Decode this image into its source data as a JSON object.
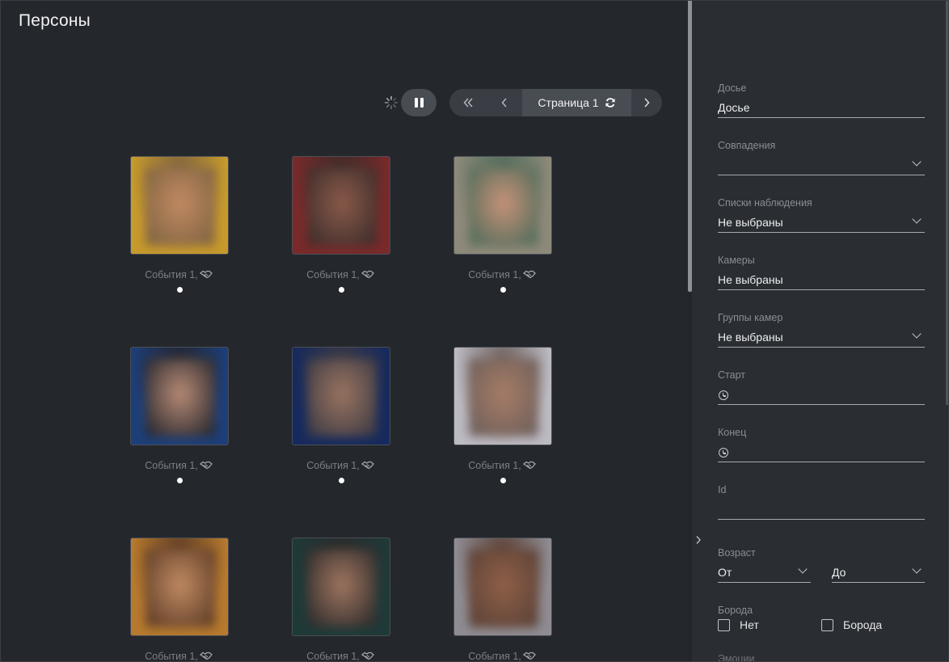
{
  "page": {
    "title": "Персоны"
  },
  "toolbar": {
    "loader_icon": "spinner-icon",
    "pause_icon": "pause-icon",
    "pager": {
      "first_icon": "double-chevron-left-icon",
      "prev_icon": "chevron-left-icon",
      "page_label": "Страница 1",
      "refresh_icon": "refresh-icon",
      "next_icon": "chevron-right-icon"
    }
  },
  "persons": [
    {
      "caption": "События 1,",
      "colors": [
        "#c79a2c",
        "#7d6240",
        "#c28a63"
      ]
    },
    {
      "caption": "События 1,",
      "colors": [
        "#7a2a2a",
        "#3b2c2a",
        "#8a5a4a"
      ]
    },
    {
      "caption": "События 1,",
      "colors": [
        "#8e8a7a",
        "#4c6a59",
        "#c79278"
      ]
    },
    {
      "caption": "События 1,",
      "colors": [
        "#1d3f79",
        "#25252b",
        "#b78b76"
      ]
    },
    {
      "caption": "События 1,",
      "colors": [
        "#162a5e",
        "#3c3a43",
        "#9a7460"
      ]
    },
    {
      "caption": "События 1,",
      "colors": [
        "#bcbac3",
        "#6b5e5a",
        "#a77c66"
      ]
    },
    {
      "caption": "События 1,",
      "colors": [
        "#b77a2e",
        "#5b3a25",
        "#c18a62"
      ]
    },
    {
      "caption": "События 1,",
      "colors": [
        "#1e3a39",
        "#2c2a2a",
        "#9f7560"
      ]
    },
    {
      "caption": "События 1,",
      "colors": [
        "#8f8c93",
        "#5a4035",
        "#8f6048"
      ]
    }
  ],
  "filters": {
    "dossier": {
      "label": "Досье",
      "value": "Досье"
    },
    "matches": {
      "label": "Совпадения",
      "value": ""
    },
    "watchlists": {
      "label": "Списки наблюдения",
      "value": "Не выбраны"
    },
    "cameras": {
      "label": "Камеры",
      "value": "Не выбраны"
    },
    "camera_groups": {
      "label": "Группы камер",
      "value": "Не выбраны"
    },
    "start": {
      "label": "Старт",
      "value": ""
    },
    "end": {
      "label": "Конец",
      "value": ""
    },
    "id": {
      "label": "Id",
      "value": ""
    },
    "age": {
      "label": "Возраст",
      "from": "От",
      "to": "До"
    },
    "beard": {
      "label": "Борода",
      "option_no": "Нет",
      "option_yes": "Борода"
    },
    "emotions_peek": "Эмоции"
  }
}
